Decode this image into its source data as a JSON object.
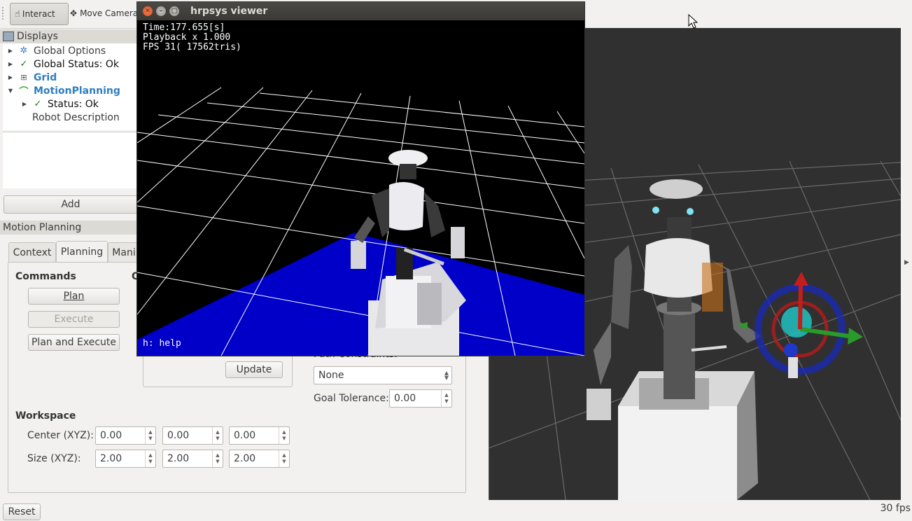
{
  "toolbar": {
    "interact_label": "Interact",
    "move_camera_label": "Move Camera"
  },
  "displays": {
    "header": "Displays",
    "items": [
      {
        "label": "Global Options",
        "icon": "gear-icon"
      },
      {
        "label": "Global Status: Ok",
        "icon": "check-icon"
      },
      {
        "label": "Grid",
        "icon": "grid-icon"
      },
      {
        "label": "MotionPlanning",
        "icon": "motion-planning-icon"
      },
      {
        "label": "Status: Ok",
        "icon": "check-icon"
      },
      {
        "label": "Robot Description"
      }
    ],
    "add_label": "Add"
  },
  "motion_planning": {
    "header": "Motion Planning",
    "tabs": [
      "Context",
      "Planning",
      "Mani"
    ],
    "commands_label": "Commands",
    "plan_label": "Plan",
    "execute_label": "Execute",
    "plan_execute_label": "Plan and Execute",
    "update_label": "Update",
    "path_constraints_label": "Path Constraints:",
    "path_constraints_value": "None",
    "goal_tolerance_label": "Goal Tolerance:",
    "goal_tolerance_value": "0.00",
    "workspace_label": "Workspace",
    "center_label": "Center (XYZ):",
    "size_label": "Size (XYZ):",
    "center": [
      "0.00",
      "0.00",
      "0.00"
    ],
    "size": [
      "2.00",
      "2.00",
      "2.00"
    ]
  },
  "hrpsys": {
    "title": "hrpsys viewer",
    "time": "Time:177.655[s]",
    "playback": "Playback x 1.000",
    "fps": "FPS 31( 17562tris)",
    "help": "h: help"
  },
  "footer": {
    "reset_label": "Reset",
    "fps": "30 fps"
  }
}
